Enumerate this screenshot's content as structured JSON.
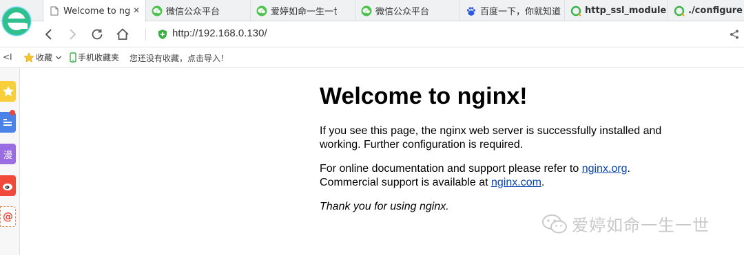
{
  "browser": {
    "tabs": [
      {
        "label": "Welcome to nginx!",
        "icon": "page-icon",
        "active": true
      },
      {
        "label": "微信公众平台",
        "icon": "wechat-icon"
      },
      {
        "label": "爱婷如命一生一世",
        "icon": "wechat-icon"
      },
      {
        "label": "微信公众平台",
        "icon": "wechat-icon"
      },
      {
        "label": "百度一下，你就知道",
        "icon": "baidu-icon"
      },
      {
        "label": "http_ssl_module",
        "icon": "search-result-icon"
      },
      {
        "label": "./configure \\",
        "icon": "search-result-icon"
      }
    ],
    "close_glyph": "✕",
    "address_bar": {
      "url": "http://192.168.0.130/"
    },
    "bookmarks_bar": {
      "collapse_glyph": "<I",
      "favorites_label": "收藏",
      "mobile_favorites_label": "手机收藏夹",
      "import_hint": "您还没有收藏，点击导入！"
    },
    "sidebar": {
      "items": [
        "favorites-icon",
        "news-icon",
        "comic-icon",
        "weibo-icon",
        "mail-icon"
      ],
      "comic_glyph": "漫"
    }
  },
  "page": {
    "heading": "Welcome to nginx!",
    "para1": "If you see this page, the nginx web server is successfully installed and working. Further configuration is required.",
    "para2_intro": "For online documentation and support please refer to ",
    "link_org": "nginx.org",
    "para2_mid_end": ".",
    "para2_commercial": "Commercial support is available at ",
    "link_com": "nginx.com",
    "para2_tail": ".",
    "thanks": "Thank you for using nginx."
  },
  "watermark": {
    "text": "爱婷如命一生一世"
  },
  "colors": {
    "link": "#0645ad",
    "secure_green": "#3cb043",
    "brand_green": "#35c58a"
  }
}
